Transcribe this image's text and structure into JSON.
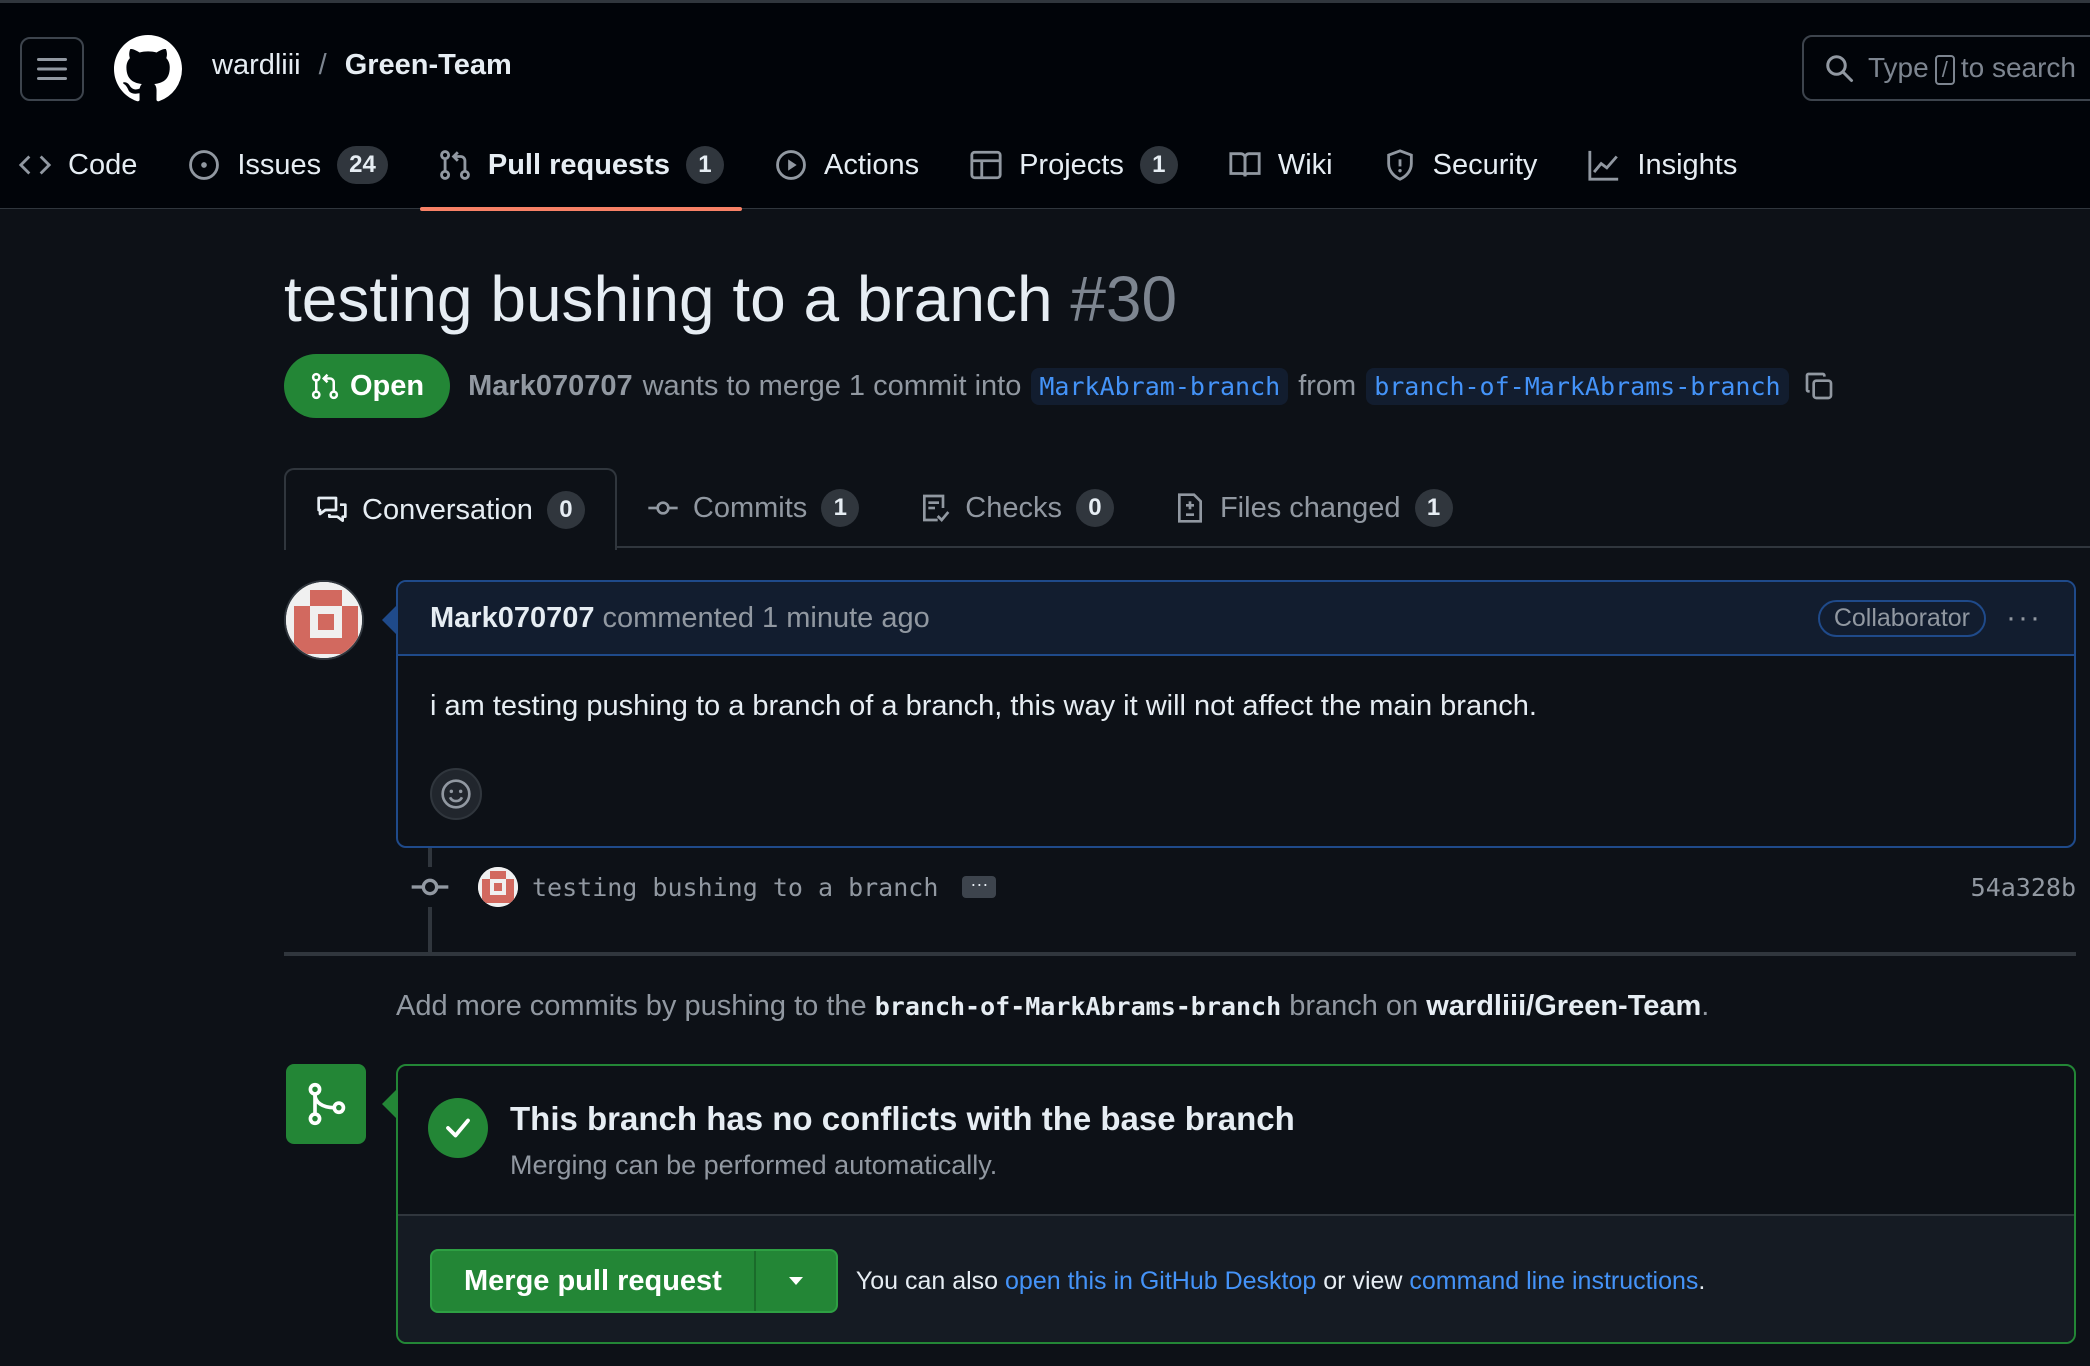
{
  "header": {
    "owner": "wardliii",
    "separator": "/",
    "repo": "Green-Team",
    "search_prefix": "Type",
    "search_key": "/",
    "search_suffix": "to search"
  },
  "repo_nav": [
    {
      "label": "Code",
      "icon": "code-icon"
    },
    {
      "label": "Issues",
      "icon": "issue-opened-icon",
      "count": "24"
    },
    {
      "label": "Pull requests",
      "icon": "git-pull-request-icon",
      "count": "1",
      "active": true
    },
    {
      "label": "Actions",
      "icon": "play-icon"
    },
    {
      "label": "Projects",
      "icon": "table-icon",
      "count": "1"
    },
    {
      "label": "Wiki",
      "icon": "book-icon"
    },
    {
      "label": "Security",
      "icon": "shield-icon"
    },
    {
      "label": "Insights",
      "icon": "graph-icon"
    }
  ],
  "pr": {
    "title": "testing bushing to a branch",
    "number": "#30",
    "state": "Open",
    "author": "Mark070707",
    "merge_text": "wants to merge 1 commit into",
    "base_branch": "MarkAbram-branch",
    "from_text": "from",
    "head_branch": "branch-of-MarkAbrams-branch"
  },
  "pr_tabs": [
    {
      "label": "Conversation",
      "count": "0",
      "icon": "comment-discussion-icon",
      "active": true
    },
    {
      "label": "Commits",
      "count": "1",
      "icon": "git-commit-icon"
    },
    {
      "label": "Checks",
      "count": "0",
      "icon": "checklist-icon"
    },
    {
      "label": "Files changed",
      "count": "1",
      "icon": "file-diff-icon"
    }
  ],
  "comment": {
    "author": "Mark070707",
    "action": "commented 1 minute ago",
    "role": "Collaborator",
    "more": "···",
    "body": "i am testing pushing to a branch of a branch, this way it will not affect the main branch."
  },
  "commit": {
    "message": "testing bushing to a branch",
    "expand": "···",
    "sha": "54a328b"
  },
  "push_note": {
    "prefix": "Add more commits by pushing to the",
    "branch": "branch-of-MarkAbrams-branch",
    "middle": "branch on",
    "repo": "wardliii/Green-Team",
    "suffix": "."
  },
  "merge": {
    "title": "This branch has no conflicts with the base branch",
    "subtitle": "Merging can be performed automatically.",
    "button": "Merge pull request",
    "hint_prefix": "You can also",
    "desktop_link": "open this in GitHub Desktop",
    "hint_middle": "or view",
    "cli_link": "command line instructions",
    "hint_suffix": "."
  },
  "colors": {
    "accent_green": "#238636",
    "link_blue": "#4493f8",
    "active_underline": "#f78166",
    "background": "#0d1117"
  }
}
